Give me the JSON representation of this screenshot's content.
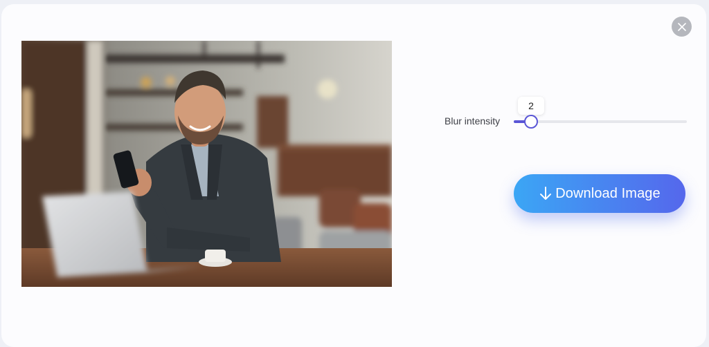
{
  "dialog": {
    "close_icon": "close-icon",
    "photo": {
      "subject": "photo of smiling man using smartphone at laptop in cafe"
    },
    "blur": {
      "label": "Blur intensity",
      "value": "2",
      "fraction": 0.1,
      "accent_color": "#5a56d6"
    },
    "download": {
      "label": "Download Image",
      "icon": "arrow-down-icon",
      "gradient_start": "#3ba6f5",
      "gradient_end": "#5567ec"
    }
  }
}
